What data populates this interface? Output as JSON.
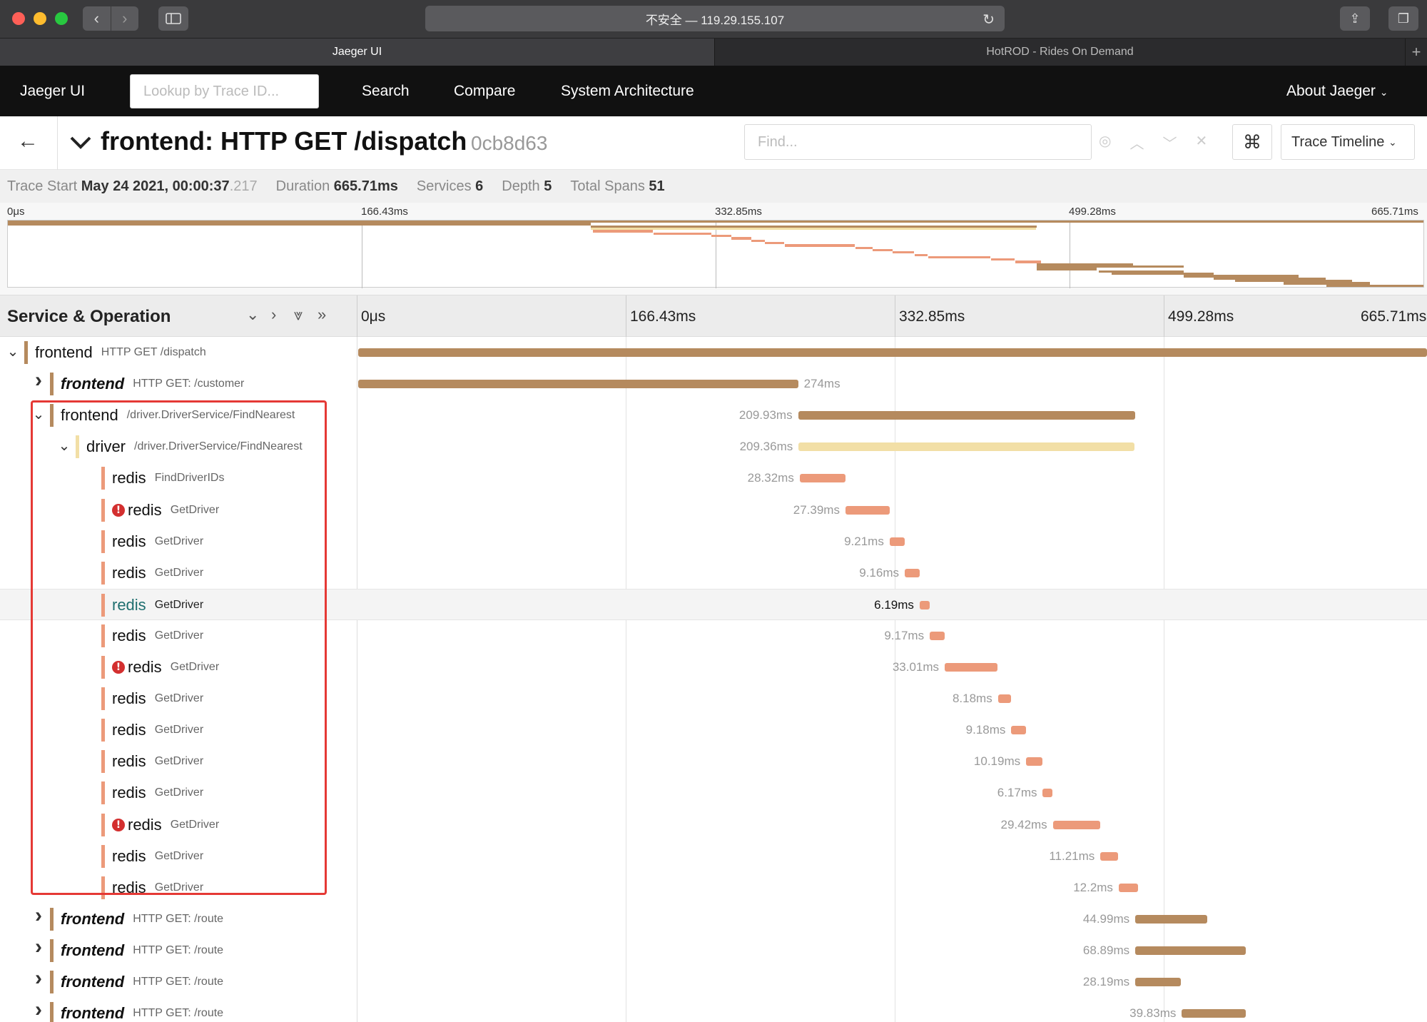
{
  "browser": {
    "url": "不安全 — 119.29.155.107",
    "tabs": [
      {
        "label": "Jaeger UI",
        "active": true
      },
      {
        "label": "HotROD - Rides On Demand",
        "active": false
      }
    ]
  },
  "nav": {
    "brand": "Jaeger UI",
    "lookup_placeholder": "Lookup by Trace ID...",
    "links": [
      "Search",
      "Compare",
      "System Architecture"
    ],
    "about": "About Jaeger"
  },
  "trace": {
    "title": "frontend: HTTP GET /dispatch",
    "id": "0cb8d63",
    "find_placeholder": "Find...",
    "view_select": "Trace Timeline",
    "stats": {
      "start_label": "Trace Start",
      "start_value": "May 24 2021, 00:00:37",
      "start_ms": ".217",
      "duration_label": "Duration",
      "duration_value": "665.71ms",
      "services_label": "Services",
      "services_value": "6",
      "depth_label": "Depth",
      "depth_value": "5",
      "spans_label": "Total Spans",
      "spans_value": "51"
    }
  },
  "timeline": {
    "header_label": "Service & Operation",
    "ticks": [
      "0μs",
      "166.43ms",
      "332.85ms",
      "499.28ms",
      "665.71ms"
    ],
    "total_ms": 665.71
  },
  "colors": {
    "frontend": "#b58a5e",
    "driver": "#f2dfa6",
    "redis": "#ec9a7a",
    "error": "#d32f2f",
    "highlight_box": "#e53935"
  },
  "spans": [
    {
      "service": "frontend",
      "op": "HTTP GET /dispatch",
      "depth": 0,
      "chevron": "down",
      "color_key": "frontend",
      "start": 0,
      "dur": 665.71,
      "label": "",
      "italic": false
    },
    {
      "service": "frontend",
      "op": "HTTP GET: /customer",
      "depth": 1,
      "chevron": "right",
      "color_key": "frontend",
      "start": 0,
      "dur": 274,
      "label": "274ms",
      "italic": true
    },
    {
      "service": "frontend",
      "op": "/driver.DriverService/FindNearest",
      "depth": 1,
      "chevron": "down",
      "color_key": "frontend",
      "start": 274,
      "dur": 209.93,
      "label": "209.93ms",
      "italic": false
    },
    {
      "service": "driver",
      "op": "/driver.DriverService/FindNearest",
      "depth": 2,
      "chevron": "down",
      "color_key": "driver",
      "start": 274.3,
      "dur": 209.36,
      "label": "209.36ms",
      "italic": false
    },
    {
      "service": "redis",
      "op": "FindDriverIDs",
      "depth": 3,
      "chevron": "",
      "color_key": "redis",
      "start": 275,
      "dur": 28.32,
      "label": "28.32ms",
      "italic": false
    },
    {
      "service": "redis",
      "op": "GetDriver",
      "depth": 3,
      "chevron": "",
      "color_key": "redis",
      "start": 303.5,
      "dur": 27.39,
      "label": "27.39ms",
      "italic": false,
      "error": true
    },
    {
      "service": "redis",
      "op": "GetDriver",
      "depth": 3,
      "chevron": "",
      "color_key": "redis",
      "start": 331,
      "dur": 9.21,
      "label": "9.21ms",
      "italic": false
    },
    {
      "service": "redis",
      "op": "GetDriver",
      "depth": 3,
      "chevron": "",
      "color_key": "redis",
      "start": 340.4,
      "dur": 9.16,
      "label": "9.16ms",
      "italic": false
    },
    {
      "service": "redis",
      "op": "GetDriver",
      "depth": 3,
      "chevron": "",
      "color_key": "redis",
      "start": 349.7,
      "dur": 6.19,
      "label": "6.19ms",
      "italic": false,
      "highlight": true
    },
    {
      "service": "redis",
      "op": "GetDriver",
      "depth": 3,
      "chevron": "",
      "color_key": "redis",
      "start": 356,
      "dur": 9.17,
      "label": "9.17ms",
      "italic": false
    },
    {
      "service": "redis",
      "op": "GetDriver",
      "depth": 3,
      "chevron": "",
      "color_key": "redis",
      "start": 365.3,
      "dur": 33.01,
      "label": "33.01ms",
      "italic": false,
      "error": true
    },
    {
      "service": "redis",
      "op": "GetDriver",
      "depth": 3,
      "chevron": "",
      "color_key": "redis",
      "start": 398.5,
      "dur": 8.18,
      "label": "8.18ms",
      "italic": false
    },
    {
      "service": "redis",
      "op": "GetDriver",
      "depth": 3,
      "chevron": "",
      "color_key": "redis",
      "start": 406.8,
      "dur": 9.18,
      "label": "9.18ms",
      "italic": false
    },
    {
      "service": "redis",
      "op": "GetDriver",
      "depth": 3,
      "chevron": "",
      "color_key": "redis",
      "start": 416,
      "dur": 10.19,
      "label": "10.19ms",
      "italic": false
    },
    {
      "service": "redis",
      "op": "GetDriver",
      "depth": 3,
      "chevron": "",
      "color_key": "redis",
      "start": 426.4,
      "dur": 6.17,
      "label": "6.17ms",
      "italic": false
    },
    {
      "service": "redis",
      "op": "GetDriver",
      "depth": 3,
      "chevron": "",
      "color_key": "redis",
      "start": 432.7,
      "dur": 29.42,
      "label": "29.42ms",
      "italic": false,
      "error": true
    },
    {
      "service": "redis",
      "op": "GetDriver",
      "depth": 3,
      "chevron": "",
      "color_key": "redis",
      "start": 462.3,
      "dur": 11.21,
      "label": "11.21ms",
      "italic": false
    },
    {
      "service": "redis",
      "op": "GetDriver",
      "depth": 3,
      "chevron": "",
      "color_key": "redis",
      "start": 473.7,
      "dur": 12.2,
      "label": "12.2ms",
      "italic": false
    },
    {
      "service": "frontend",
      "op": "HTTP GET: /route",
      "depth": 1,
      "chevron": "right",
      "color_key": "frontend",
      "start": 484,
      "dur": 44.99,
      "label": "44.99ms",
      "italic": true
    },
    {
      "service": "frontend",
      "op": "HTTP GET: /route",
      "depth": 1,
      "chevron": "right",
      "color_key": "frontend",
      "start": 484,
      "dur": 68.89,
      "label": "68.89ms",
      "italic": true
    },
    {
      "service": "frontend",
      "op": "HTTP GET: /route",
      "depth": 1,
      "chevron": "right",
      "color_key": "frontend",
      "start": 484,
      "dur": 28.19,
      "label": "28.19ms",
      "italic": true
    },
    {
      "service": "frontend",
      "op": "HTTP GET: /route",
      "depth": 1,
      "chevron": "right",
      "color_key": "frontend",
      "start": 513,
      "dur": 39.83,
      "label": "39.83ms",
      "italic": true
    }
  ],
  "minimap_bars": [
    {
      "start": 0,
      "dur": 665.71,
      "color_key": "frontend"
    },
    {
      "start": 0,
      "dur": 274,
      "color_key": "frontend"
    },
    {
      "start": 274,
      "dur": 209.93,
      "color_key": "frontend"
    },
    {
      "start": 274.3,
      "dur": 209.36,
      "color_key": "driver"
    },
    {
      "start": 275,
      "dur": 28.32,
      "color_key": "redis"
    },
    {
      "start": 303.5,
      "dur": 27.39,
      "color_key": "redis"
    },
    {
      "start": 331,
      "dur": 9.21,
      "color_key": "redis"
    },
    {
      "start": 340.4,
      "dur": 9.16,
      "color_key": "redis"
    },
    {
      "start": 349.7,
      "dur": 6.19,
      "color_key": "redis"
    },
    {
      "start": 356,
      "dur": 9.17,
      "color_key": "redis"
    },
    {
      "start": 365.3,
      "dur": 33.01,
      "color_key": "redis"
    },
    {
      "start": 398.5,
      "dur": 8.18,
      "color_key": "redis"
    },
    {
      "start": 406.8,
      "dur": 9.18,
      "color_key": "redis"
    },
    {
      "start": 416,
      "dur": 10.19,
      "color_key": "redis"
    },
    {
      "start": 426.4,
      "dur": 6.17,
      "color_key": "redis"
    },
    {
      "start": 432.7,
      "dur": 29.42,
      "color_key": "redis"
    },
    {
      "start": 462.3,
      "dur": 11.21,
      "color_key": "redis"
    },
    {
      "start": 473.7,
      "dur": 12.2,
      "color_key": "redis"
    },
    {
      "start": 484,
      "dur": 44.99,
      "color_key": "frontend"
    },
    {
      "start": 484,
      "dur": 68.89,
      "color_key": "frontend"
    },
    {
      "start": 484,
      "dur": 28.19,
      "color_key": "frontend"
    },
    {
      "start": 513,
      "dur": 39.83,
      "color_key": "frontend"
    },
    {
      "start": 519,
      "dur": 48.2,
      "color_key": "frontend"
    },
    {
      "start": 553,
      "dur": 54.1,
      "color_key": "frontend"
    },
    {
      "start": 567,
      "dur": 52.6,
      "color_key": "frontend"
    },
    {
      "start": 577,
      "dur": 55.0,
      "color_key": "frontend"
    },
    {
      "start": 600,
      "dur": 40.5,
      "color_key": "frontend"
    },
    {
      "start": 620,
      "dur": 45.7,
      "color_key": "frontend"
    }
  ]
}
